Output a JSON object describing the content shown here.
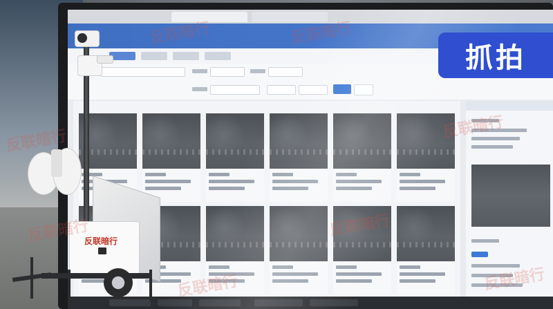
{
  "overlay": {
    "badge_label": "抓拍"
  },
  "trailer": {
    "cabinet_logo": "反联暗行"
  },
  "watermark": {
    "text": "反联暗行"
  },
  "colors": {
    "badge_bg": "#2f4fd0",
    "header_blue": "#3f6fc1",
    "watermark_red": "#dc5046"
  }
}
